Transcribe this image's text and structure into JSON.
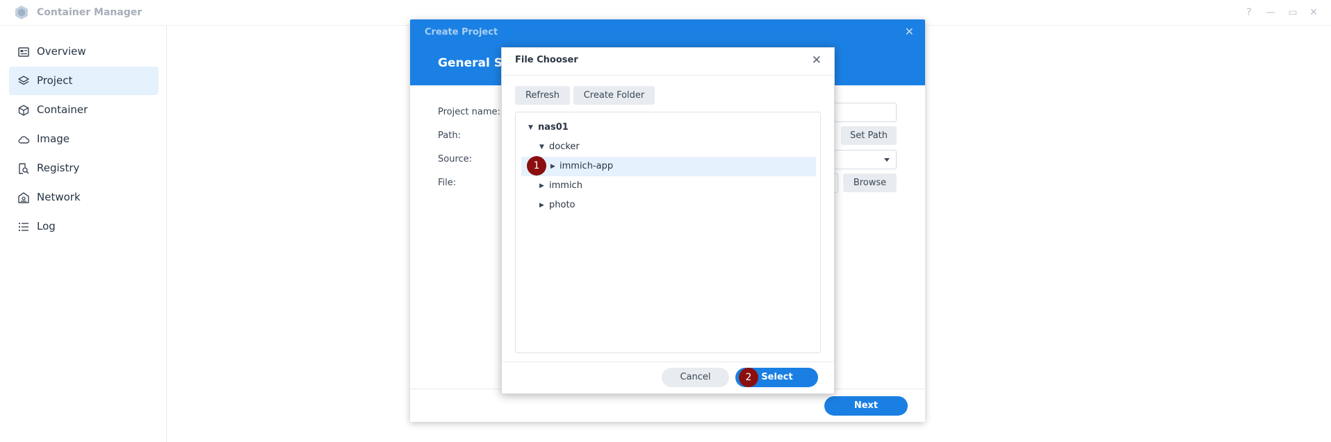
{
  "app": {
    "title": "Container Manager"
  },
  "window_controls": {
    "help": "?",
    "minimize": "—",
    "maximize": "▭",
    "close": "✕"
  },
  "sidebar": {
    "items": [
      {
        "label": "Overview",
        "icon": "overview-icon",
        "active": false
      },
      {
        "label": "Project",
        "icon": "project-layers-icon",
        "active": true
      },
      {
        "label": "Container",
        "icon": "container-cube-icon",
        "active": false
      },
      {
        "label": "Image",
        "icon": "cloud-icon",
        "active": false
      },
      {
        "label": "Registry",
        "icon": "registry-search-icon",
        "active": false
      },
      {
        "label": "Network",
        "icon": "network-house-icon",
        "active": false
      },
      {
        "label": "Log",
        "icon": "list-icon",
        "active": false
      }
    ]
  },
  "project_dialog": {
    "title": "Create Project",
    "subtitle": "General Se",
    "close": "✕",
    "labels": {
      "project_name": "Project name:",
      "path": "Path:",
      "source": "Source:",
      "file": "File:"
    },
    "set_path_button": "Set Path",
    "browse_button": "Browse",
    "next_button": "Next"
  },
  "file_chooser": {
    "title": "File Chooser",
    "close": "✕",
    "refresh_button": "Refresh",
    "create_folder_button": "Create Folder",
    "tree": [
      {
        "label": "nas01",
        "level": 0,
        "expanded": true,
        "bold": true
      },
      {
        "label": "docker",
        "level": 1,
        "expanded": true
      },
      {
        "label": "immich-app",
        "level": 2,
        "expanded": false,
        "selected": true
      },
      {
        "label": "immich",
        "level": 1,
        "expanded": false
      },
      {
        "label": "photo",
        "level": 1,
        "expanded": false
      }
    ],
    "cancel_button": "Cancel",
    "select_button": "Select"
  },
  "annotations": {
    "step1": "1",
    "step2": "2"
  },
  "colors": {
    "accent": "#1a7fe2",
    "header_blue": "#1b80e3",
    "badge": "#8b0f0f",
    "selected_bg": "#e5f1fc"
  }
}
